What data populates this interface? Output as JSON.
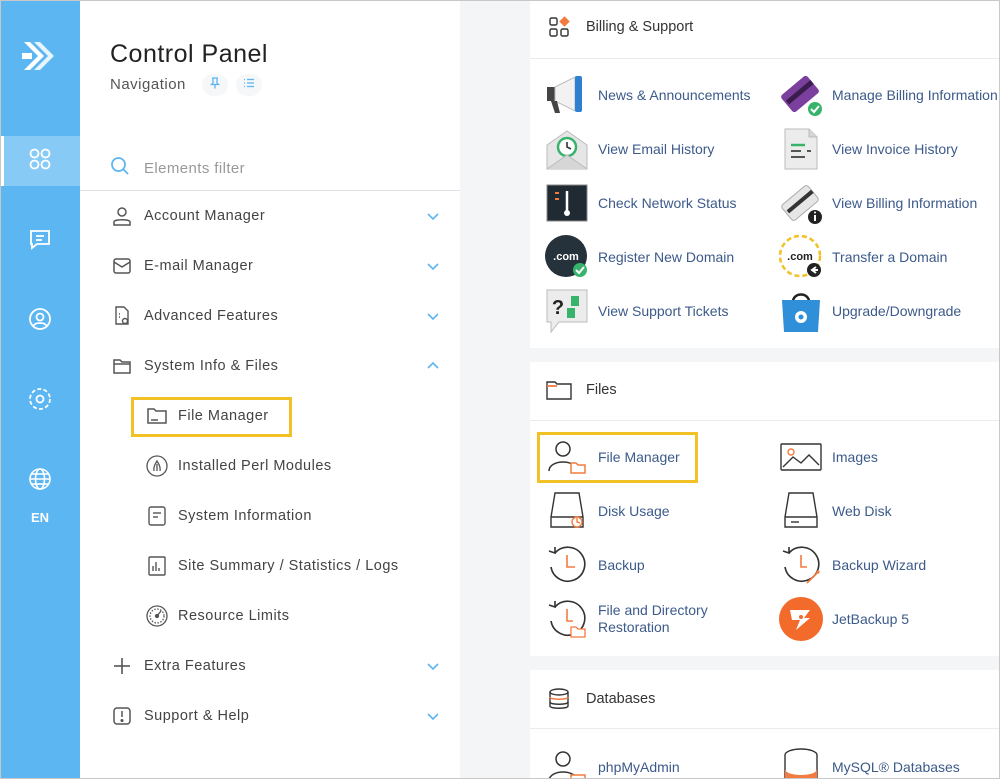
{
  "rail": {
    "items": [
      {
        "icon": "grid-icon",
        "active": true
      },
      {
        "icon": "chat-icon",
        "active": false
      },
      {
        "icon": "user-circle-icon",
        "active": false
      },
      {
        "icon": "settings-circle-icon",
        "active": false
      },
      {
        "icon": "globe-icon",
        "active": false
      }
    ],
    "language": "EN"
  },
  "nav": {
    "title": "Control Panel",
    "subtitle": "Navigation",
    "filter_placeholder": "Elements filter",
    "items": [
      {
        "label": "Account Manager",
        "icon": "user-icon",
        "expanded": false
      },
      {
        "label": "E-mail Manager",
        "icon": "mail-icon",
        "expanded": false
      },
      {
        "label": "Advanced Features",
        "icon": "doc-settings-icon",
        "expanded": false
      },
      {
        "label": "System Info & Files",
        "icon": "folder-icon",
        "expanded": true
      },
      {
        "label": "Extra Features",
        "icon": "plus-icon",
        "expanded": false
      },
      {
        "label": "Support & Help",
        "icon": "alert-icon",
        "expanded": false
      }
    ],
    "sub_items": [
      {
        "label": "File Manager",
        "icon": "folder-icon"
      },
      {
        "label": "Installed Perl Modules",
        "icon": "perl-icon"
      },
      {
        "label": "System Information",
        "icon": "document-icon"
      },
      {
        "label": "Site Summary / Statistics / Logs",
        "icon": "stats-icon"
      },
      {
        "label": "Resource Limits",
        "icon": "gauge-icon"
      }
    ]
  },
  "billing": {
    "title": "Billing & Support",
    "tiles": [
      {
        "label": "News & Announcements",
        "icon": "megaphone-icon"
      },
      {
        "label": "Manage Billing Information",
        "icon": "credit-card-icon"
      },
      {
        "label": "View Email History",
        "icon": "email-history-icon"
      },
      {
        "label": "View Invoice History",
        "icon": "invoice-icon"
      },
      {
        "label": "Check Network Status",
        "icon": "network-status-icon"
      },
      {
        "label": "View Billing Information",
        "icon": "billing-info-icon"
      },
      {
        "label": "Register New Domain",
        "icon": "domain-register-icon"
      },
      {
        "label": "Transfer a Domain",
        "icon": "domain-transfer-icon"
      },
      {
        "label": "View Support Tickets",
        "icon": "support-tickets-icon"
      },
      {
        "label": "Upgrade/Downgrade",
        "icon": "upgrade-bag-icon"
      }
    ]
  },
  "files": {
    "title": "Files",
    "tiles": [
      {
        "label": "File Manager",
        "icon": "file-manager-icon"
      },
      {
        "label": "Images",
        "icon": "images-icon"
      },
      {
        "label": "Disk Usage",
        "icon": "disk-usage-icon"
      },
      {
        "label": "Web Disk",
        "icon": "web-disk-icon"
      },
      {
        "label": "Backup",
        "icon": "backup-icon"
      },
      {
        "label": "Backup Wizard",
        "icon": "backup-wizard-icon"
      },
      {
        "label": "File and Directory",
        "label2": "Restoration",
        "icon": "restore-icon"
      },
      {
        "label": "JetBackup 5",
        "icon": "jetbackup-icon"
      }
    ]
  },
  "databases": {
    "title": "Databases",
    "tiles": [
      {
        "label": "phpMyAdmin",
        "icon": "phpmyadmin-icon"
      },
      {
        "label": "MySQL® Databases",
        "icon": "mysql-icon"
      }
    ]
  },
  "colors": {
    "rail": "#5bb6f2",
    "accent_orange": "#f47b3f",
    "highlight": "#f2c125",
    "link": "#3c5a8a"
  }
}
